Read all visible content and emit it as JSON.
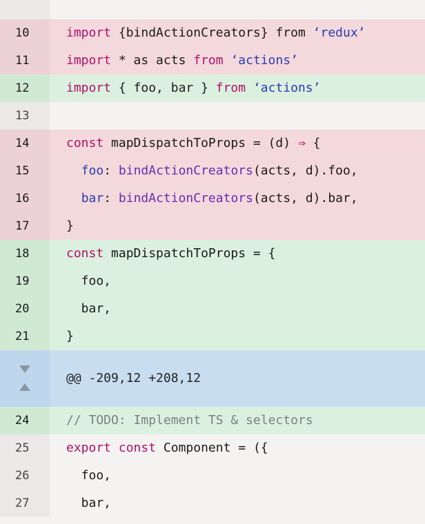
{
  "diff": {
    "rows": [
      {
        "type": "ctx",
        "num": "",
        "tokens": []
      },
      {
        "type": "del",
        "num": "10",
        "tokens": [
          {
            "t": "import",
            "c": "kw"
          },
          {
            "t": " {bindActionCreators} from ",
            "c": ""
          },
          {
            "t": "‘redux’",
            "c": "str"
          }
        ]
      },
      {
        "type": "del",
        "num": "11",
        "tokens": [
          {
            "t": "import",
            "c": "kw"
          },
          {
            "t": " * as acts ",
            "c": ""
          },
          {
            "t": "from",
            "c": "kw"
          },
          {
            "t": " ",
            "c": ""
          },
          {
            "t": "‘actions’",
            "c": "str"
          }
        ]
      },
      {
        "type": "add",
        "num": "12",
        "tokens": [
          {
            "t": "import",
            "c": "kw"
          },
          {
            "t": " { foo, bar } ",
            "c": ""
          },
          {
            "t": "from",
            "c": "kw"
          },
          {
            "t": " ",
            "c": ""
          },
          {
            "t": "‘actions’",
            "c": "str"
          }
        ]
      },
      {
        "type": "ctx",
        "num": "13",
        "tokens": []
      },
      {
        "type": "del",
        "num": "14",
        "tokens": [
          {
            "t": "const",
            "c": "kw"
          },
          {
            "t": " mapDispatchToProps = (d) ",
            "c": ""
          },
          {
            "t": "⇒",
            "c": "arrow"
          },
          {
            "t": " {",
            "c": ""
          }
        ]
      },
      {
        "type": "del",
        "num": "15",
        "tokens": [
          {
            "t": "  ",
            "c": ""
          },
          {
            "t": "foo",
            "c": "prop"
          },
          {
            "t": ": ",
            "c": ""
          },
          {
            "t": "bindActionCreators",
            "c": "fn"
          },
          {
            "t": "(acts, d).foo,",
            "c": ""
          }
        ]
      },
      {
        "type": "del",
        "num": "16",
        "tokens": [
          {
            "t": "  ",
            "c": ""
          },
          {
            "t": "bar",
            "c": "prop"
          },
          {
            "t": ": ",
            "c": ""
          },
          {
            "t": "bindActionCreators",
            "c": "fn"
          },
          {
            "t": "(acts, d).bar,",
            "c": ""
          }
        ]
      },
      {
        "type": "del",
        "num": "17",
        "tokens": [
          {
            "t": "}",
            "c": ""
          }
        ]
      },
      {
        "type": "add",
        "num": "18",
        "tokens": [
          {
            "t": "const",
            "c": "kw"
          },
          {
            "t": " mapDispatchToProps = {",
            "c": ""
          }
        ]
      },
      {
        "type": "add",
        "num": "19",
        "tokens": [
          {
            "t": "  foo,",
            "c": ""
          }
        ]
      },
      {
        "type": "add",
        "num": "20",
        "tokens": [
          {
            "t": "  bar,",
            "c": ""
          }
        ]
      },
      {
        "type": "add",
        "num": "21",
        "tokens": [
          {
            "t": "}",
            "c": ""
          }
        ]
      },
      {
        "type": "hunk",
        "num": "",
        "tokens": [
          {
            "t": "@@ -209,12 +208,12",
            "c": ""
          }
        ]
      },
      {
        "type": "add",
        "num": "24",
        "tokens": [
          {
            "t": "// TODO: Implement TS & selectors",
            "c": "cm"
          }
        ]
      },
      {
        "type": "ctx",
        "num": "25",
        "tokens": [
          {
            "t": "export",
            "c": "kw"
          },
          {
            "t": " ",
            "c": ""
          },
          {
            "t": "const",
            "c": "kw"
          },
          {
            "t": " Component = ({",
            "c": ""
          }
        ]
      },
      {
        "type": "ctx",
        "num": "26",
        "tokens": [
          {
            "t": "  foo,",
            "c": ""
          }
        ]
      },
      {
        "type": "ctx",
        "num": "27",
        "tokens": [
          {
            "t": "  bar,",
            "c": ""
          }
        ]
      }
    ],
    "hunk_icons": {
      "up": "expand-up-icon",
      "down": "expand-down-icon"
    },
    "colors": {
      "deletion_bg": "#f3d9dc",
      "addition_bg": "#dbf0df",
      "hunk_bg": "#c8ddf0",
      "keyword": "#b0106a",
      "string": "#2a3bb0",
      "comment": "#7d8082"
    }
  }
}
